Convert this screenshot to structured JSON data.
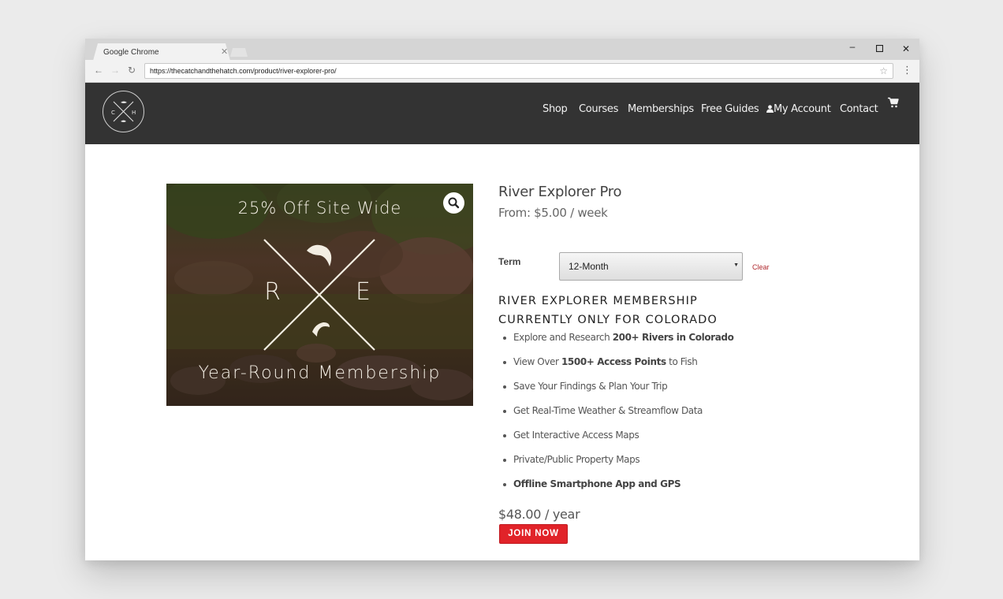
{
  "browser": {
    "tab_title": "Google Chrome",
    "url": "https://thecatchandthehatch.com/product/river-explorer-pro/"
  },
  "nav": {
    "items": [
      "Shop",
      "Courses",
      "Memberships",
      "Free Guides",
      "My Account",
      "Contact"
    ]
  },
  "product_image": {
    "top_text": "25% Off Site Wide",
    "letter_left": "R",
    "letter_right": "E",
    "bottom_text": "Year-Round Membership"
  },
  "product": {
    "title": "River Explorer Pro",
    "price_from": "From: $5.00 / week",
    "term_label": "Term",
    "term_value": "12-Month",
    "clear_label": "Clear",
    "heading_line1": "RIVER EXPLORER MEMBERSHIP",
    "heading_line2": "CURRENTLY ONLY FOR COLORADO",
    "features": [
      {
        "pre": "Explore and Research ",
        "bold": "200+ Rivers in Colorado",
        "post": ""
      },
      {
        "pre": "View Over ",
        "bold": "1500+ Access Points",
        "post": " to Fish"
      },
      {
        "pre": "Save Your Findings & Plan Your Trip",
        "bold": "",
        "post": ""
      },
      {
        "pre": "Get Real-Time Weather & Streamflow Data",
        "bold": "",
        "post": ""
      },
      {
        "pre": "Get Interactive Access Maps",
        "bold": "",
        "post": ""
      },
      {
        "pre": "Private/Public Property Maps",
        "bold": "",
        "post": ""
      },
      {
        "pre": "",
        "bold": "Offline Smartphone App and GPS",
        "post": ""
      }
    ],
    "price_year": "$48.00 / year",
    "cta_label": "JOIN NOW"
  },
  "colors": {
    "header_bg": "#333333",
    "cta": "#e12329",
    "clear_link": "#b0282d"
  }
}
